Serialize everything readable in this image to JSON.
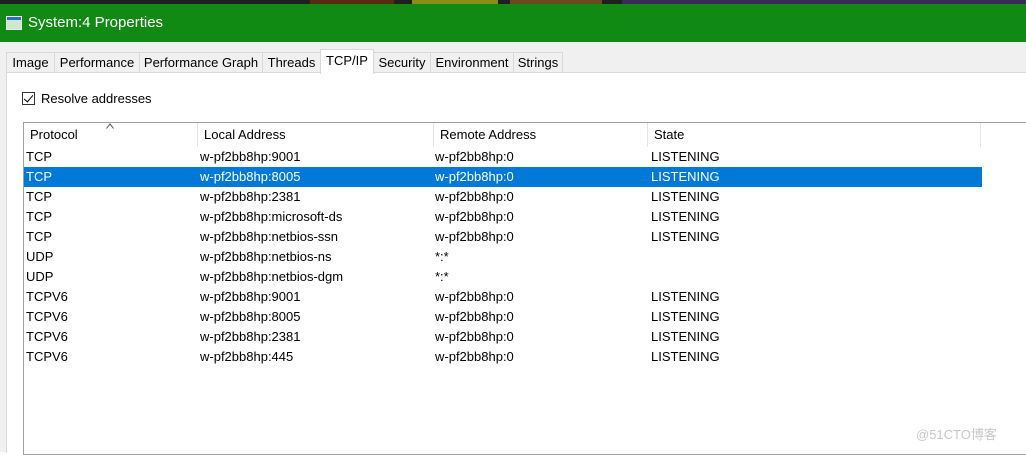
{
  "window": {
    "title": "System:4 Properties",
    "accent_color": "#118a14",
    "selection_color": "#0078d7"
  },
  "tabs": [
    {
      "label": "Image"
    },
    {
      "label": "Performance"
    },
    {
      "label": "Performance Graph"
    },
    {
      "label": "Threads"
    },
    {
      "label": "TCP/IP",
      "active": true
    },
    {
      "label": "Security"
    },
    {
      "label": "Environment"
    },
    {
      "label": "Strings"
    }
  ],
  "options": {
    "resolve_label": "Resolve addresses",
    "resolve_checked": true
  },
  "table": {
    "columns": [
      "Protocol",
      "Local Address",
      "Remote Address",
      "State"
    ],
    "sort_column": "Protocol",
    "sort_direction": "ascending",
    "selected_row": 1,
    "rows": [
      [
        "TCP",
        "w-pf2bb8hp:9001",
        "w-pf2bb8hp:0",
        "LISTENING"
      ],
      [
        "TCP",
        "w-pf2bb8hp:8005",
        "w-pf2bb8hp:0",
        "LISTENING"
      ],
      [
        "TCP",
        "w-pf2bb8hp:2381",
        "w-pf2bb8hp:0",
        "LISTENING"
      ],
      [
        "TCP",
        "w-pf2bb8hp:microsoft-ds",
        "w-pf2bb8hp:0",
        "LISTENING"
      ],
      [
        "TCP",
        "w-pf2bb8hp:netbios-ssn",
        "w-pf2bb8hp:0",
        "LISTENING"
      ],
      [
        "UDP",
        "w-pf2bb8hp:netbios-ns",
        "*:*",
        ""
      ],
      [
        "UDP",
        "w-pf2bb8hp:netbios-dgm",
        "*:*",
        ""
      ],
      [
        "TCPV6",
        "w-pf2bb8hp:9001",
        "w-pf2bb8hp:0",
        "LISTENING"
      ],
      [
        "TCPV6",
        "w-pf2bb8hp:8005",
        "w-pf2bb8hp:0",
        "LISTENING"
      ],
      [
        "TCPV6",
        "w-pf2bb8hp:2381",
        "w-pf2bb8hp:0",
        "LISTENING"
      ],
      [
        "TCPV6",
        "w-pf2bb8hp:445",
        "w-pf2bb8hp:0",
        "LISTENING"
      ]
    ]
  },
  "watermark": "@51CTO博客"
}
